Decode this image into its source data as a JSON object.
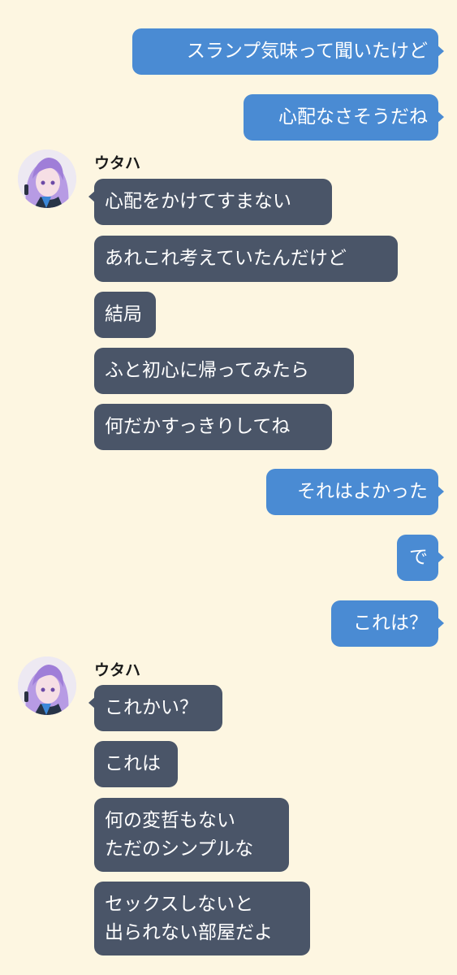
{
  "colors": {
    "background": "#fdf6e1",
    "outgoing_bubble": "#4a8bd3",
    "incoming_bubble": "#4a5568"
  },
  "chat": {
    "sender_name": "ウタハ",
    "avatar_icon": "purple-haired-girl-avatar-icon",
    "messages": [
      "スランプ気味って聞いたけど",
      "心配なさそうだね",
      "心配をかけてすまない",
      "あれこれ考えていたんだけど",
      "結局",
      "ふと初心に帰ってみたら",
      "何だかすっきりしてね",
      "それはよかった",
      "で",
      "これは？",
      "これかい？",
      "これは",
      "何の変哲もない\nただのシンプルな",
      "セックスしないと\n出られない部屋だよ"
    ]
  }
}
